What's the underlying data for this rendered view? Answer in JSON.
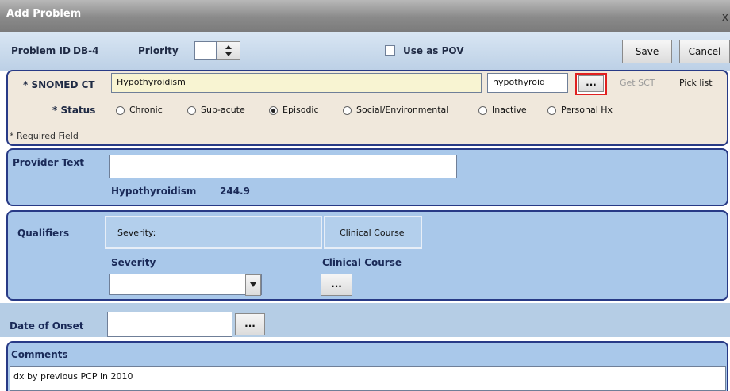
{
  "window": {
    "title": "Add Problem",
    "close_glyph": "x"
  },
  "header": {
    "problem_id_label": "Problem ID",
    "problem_id_value": "DB-4",
    "priority_label": "Priority",
    "priority_value": "",
    "use_as_pov_label": "Use as POV",
    "use_as_pov_checked": false,
    "save_label": "Save",
    "cancel_label": "Cancel"
  },
  "snomed": {
    "label": "* SNOMED CT",
    "value": "Hypothyroidism",
    "search_value": "hypothyroid",
    "ellipsis_label": "...",
    "get_sct_label": "Get SCT",
    "pick_list_label": "Pick list",
    "status_label": "* Status",
    "status_options": [
      "Chronic",
      "Sub-acute",
      "Episodic",
      "Social/Environmental",
      "Inactive",
      "Personal Hx"
    ],
    "status_selected": "Episodic",
    "required_note": "* Required Field"
  },
  "provider": {
    "label": "Provider Text",
    "value": "",
    "diagnosis_name": "Hypothyroidism",
    "diagnosis_code": "244.9"
  },
  "qualifiers": {
    "label": "Qualifiers",
    "tabs": [
      "Severity:",
      "Clinical Course"
    ],
    "severity_label": "Severity",
    "severity_value": "",
    "clinical_course_label": "Clinical Course",
    "clinical_course_button": "..."
  },
  "onset": {
    "label": "Date of Onset",
    "value": "",
    "button": "..."
  },
  "comments": {
    "label": "Comments",
    "value": "dx by previous PCP in 2010"
  },
  "colors": {
    "panel_border": "#283a86",
    "panel_blue": "#a9c8ea",
    "snomed_bg": "#f0e8dc",
    "highlight_red": "#e02020"
  }
}
